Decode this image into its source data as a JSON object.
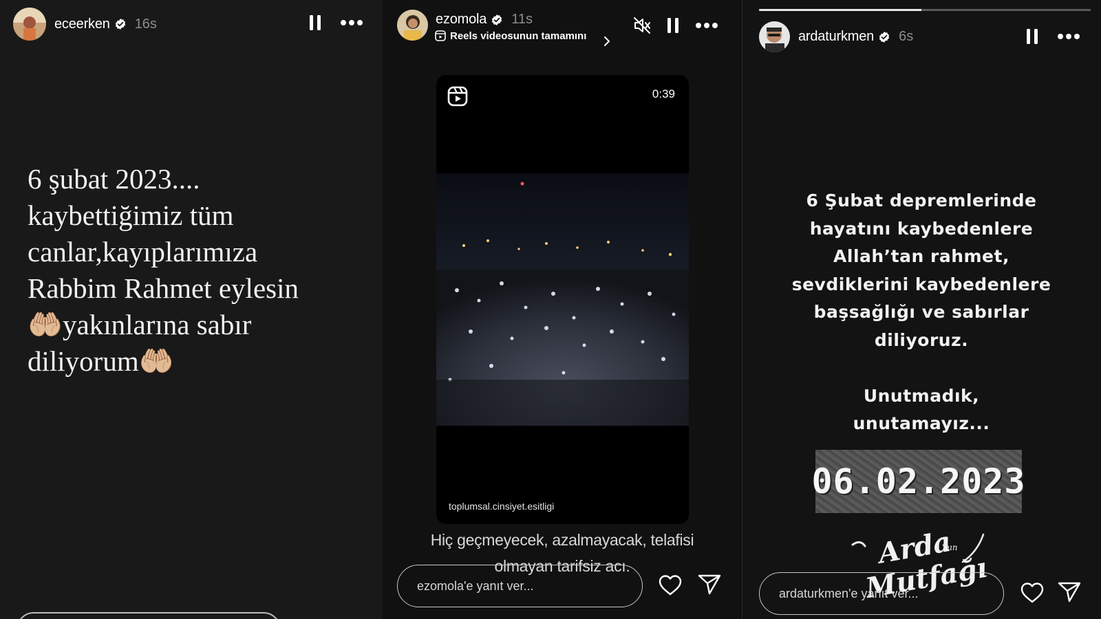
{
  "stories": [
    {
      "username": "eceerken",
      "age": "16s",
      "lines": [
        "6 şubat 2023....",
        "kaybettiğimiz tüm",
        "canlar,kayıplarımıza",
        "Rabbim Rahmet eylesin",
        "🤲🏼yakınlarına sabır",
        "diliyorum🤲🏼"
      ],
      "controls": [
        "pause-icon",
        "more-icon"
      ]
    },
    {
      "username": "ezomola",
      "age": "11s",
      "reels_link": "Reels videosunun tamamını",
      "reel_time": "0:39",
      "reel_source": "toplumsal.cinsiyet.esitligi",
      "caption_line1": "Hiç geçmeyecek, azalmayacak, telafisi",
      "caption_line2": "olmayan tarifsiz acı.",
      "reply_placeholder": "ezomola'e yanıt ver...",
      "controls": [
        "mute-icon",
        "pause-icon",
        "more-icon",
        "like-icon",
        "share-icon"
      ]
    },
    {
      "username": "ardaturkmen",
      "age": "6s",
      "progress": 0.49,
      "lines": [
        "6 Şubat depremlerinde",
        "hayatını kaybedenlere",
        "Allah’tan rahmet,",
        "sevdiklerini kaybedenlere",
        "başsağlığı ve sabırlar",
        "diliyoruz."
      ],
      "lines2": [
        "Unutmadık,",
        "unutamayız..."
      ],
      "date_plate": "06.02.2023",
      "brand": "Arda'nın Mutfağı",
      "reply_placeholder": "ardaturkmen'e yanıt ver...",
      "controls": [
        "pause-icon",
        "more-icon",
        "like-icon",
        "share-icon"
      ]
    }
  ],
  "colors": {
    "background": "#191919",
    "muted_text": "#8d8d8d",
    "verified_badge": "#ffffff"
  }
}
